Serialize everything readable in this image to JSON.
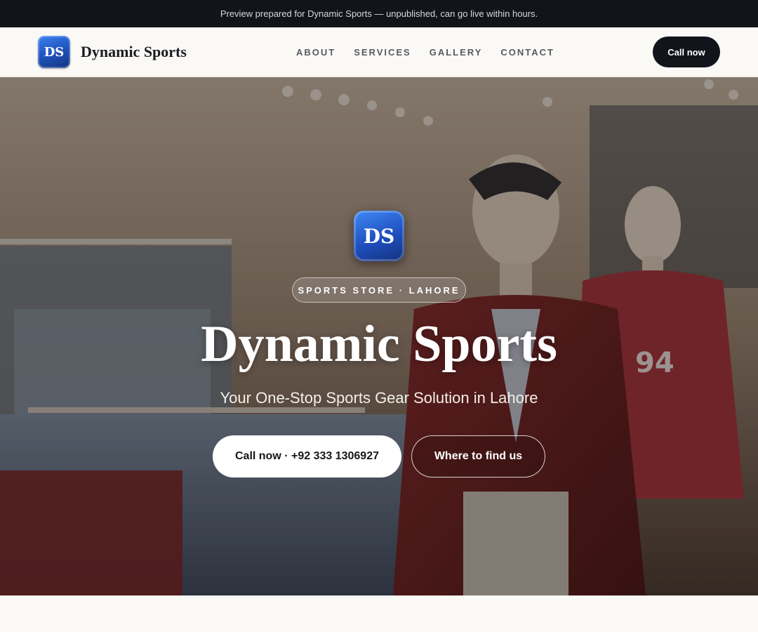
{
  "announcement": "Preview prepared for Dynamic Sports — unpublished, can go live within hours.",
  "brand": {
    "logo_initials": "DS",
    "name": "Dynamic Sports"
  },
  "nav": {
    "items": [
      "ABOUT",
      "SERVICES",
      "GALLERY",
      "CONTACT"
    ]
  },
  "header": {
    "call_label": "Call now"
  },
  "hero": {
    "logo_initials": "DS",
    "badge": "SPORTS STORE · LAHORE",
    "title": "Dynamic Sports",
    "subtitle": "Your One-Stop Sports Gear Solution in Lahore",
    "primary_cta": "Call now · +92 333 1306927",
    "secondary_cta": "Where to find us",
    "background_image": "clothing store interior with mannequins"
  },
  "colors": {
    "dark": "#11141a",
    "brand_blue": "#1f4fbf",
    "background": "#faf9f6"
  }
}
